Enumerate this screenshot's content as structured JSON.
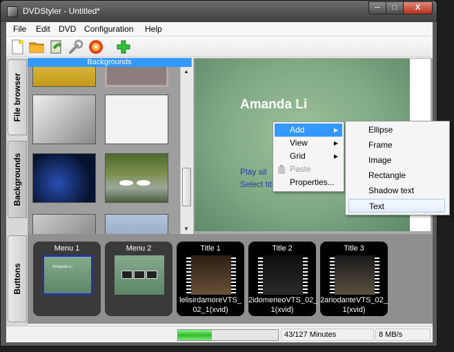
{
  "window": {
    "title": "DVDStyler - Untitled*",
    "min": "─",
    "max": "□",
    "close": "X"
  },
  "menubar": [
    "File",
    "Edit",
    "DVD",
    "Configuration",
    "Help"
  ],
  "side_tabs": {
    "file_browser": "File browser",
    "backgrounds": "Backgrounds",
    "buttons": "Buttons"
  },
  "backgrounds_panel": {
    "header": "Backgrounds"
  },
  "canvas": {
    "title": "Amanda Li",
    "buttons": [
      "Play all",
      "Select titl"
    ]
  },
  "context_menu": {
    "items": [
      {
        "label": "Add",
        "submenu": true,
        "highlighted": true
      },
      {
        "label": "View",
        "submenu": true
      },
      {
        "label": "Grid",
        "submenu": true
      },
      {
        "label": "Paste",
        "disabled": true
      },
      {
        "label": "Properties..."
      }
    ]
  },
  "add_submenu": {
    "items": [
      "Ellipse",
      "Frame",
      "Image",
      "Rectangle",
      "Shadow text",
      "Text"
    ],
    "hovered": "Text"
  },
  "titleset": {
    "cards": [
      {
        "label": "Menu 1",
        "sub": ""
      },
      {
        "label": "Menu 2",
        "sub": ""
      },
      {
        "label": "Title 1",
        "sub": "lelisirdamoreVTS_02_1(xvid)",
        "line1": "lelisirdamoreVTS_",
        "line2": "02_1(xvid)"
      },
      {
        "label": "Title 2",
        "sub": "2idomeneoVTS_02_1(xvid)",
        "line1": "2idomeneoVTS_02_",
        "line2": "1(xvid)"
      },
      {
        "label": "Title 3",
        "sub": "2ariodanteVTS_02_1(xvid)",
        "line1": "2ariodanteVTS_02_",
        "line2": "1(xvid)"
      }
    ],
    "menu1_preview_title": "Amanda Li"
  },
  "status": {
    "progress_fraction": 0.3386,
    "minutes": "43/127 Minutes",
    "bitrate": "8 MB/s"
  },
  "colors": {
    "accent": "#3399ff",
    "progress": "#2fbe2b"
  }
}
